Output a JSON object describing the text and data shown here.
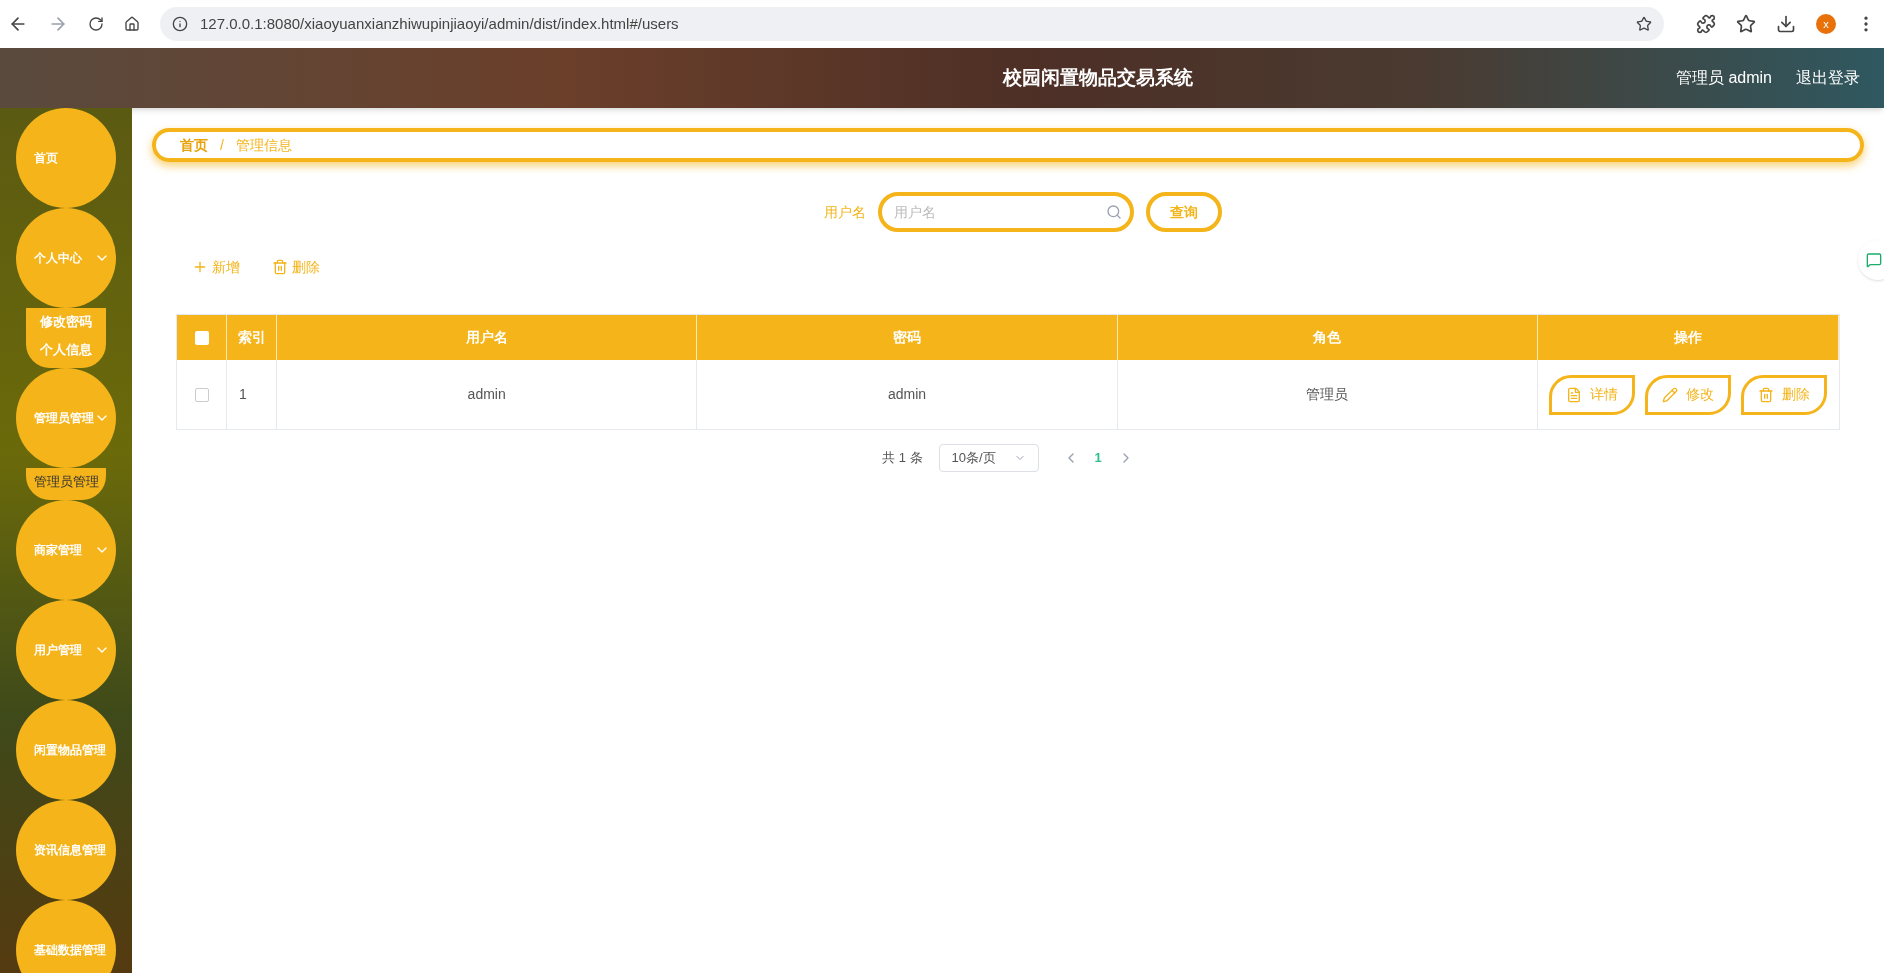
{
  "browser": {
    "url": "127.0.0.1:8080/xiaoyuanxianzhiwupinjiaoyi/admin/dist/index.html#/users",
    "profile": "x"
  },
  "header": {
    "title": "校园闲置物品交易系统",
    "user": "管理员 admin",
    "logout": "退出登录"
  },
  "sidebar": {
    "items": [
      {
        "label": "首页",
        "expandable": false
      },
      {
        "label": "个人中心",
        "expandable": true,
        "children": [
          {
            "label": "修改密码",
            "selected": false
          },
          {
            "label": "个人信息",
            "selected": false
          }
        ]
      },
      {
        "label": "管理员管理",
        "expandable": true,
        "children": [
          {
            "label": "管理员管理",
            "selected": true
          }
        ]
      },
      {
        "label": "商家管理",
        "expandable": true
      },
      {
        "label": "用户管理",
        "expandable": true
      },
      {
        "label": "闲置物品管理",
        "expandable": false
      },
      {
        "label": "资讯信息管理",
        "expandable": false
      },
      {
        "label": "基础数据管理",
        "expandable": false
      }
    ]
  },
  "breadcrumb_separator": "/",
  "breadcrumb": [
    {
      "label": "首页",
      "current": false
    },
    {
      "label": "管理信息",
      "current": true
    }
  ],
  "search": {
    "label": "用户名",
    "placeholder": "用户名",
    "button": "查询"
  },
  "actions": [
    {
      "kind": "add",
      "label": "新增"
    },
    {
      "kind": "delete",
      "label": "删除"
    }
  ],
  "table": {
    "select_all": {
      "checked": false
    },
    "columns": [
      "索引",
      "用户名",
      "密码",
      "角色",
      "操作"
    ],
    "rows": [
      {
        "checked": false,
        "cells": [
          "1",
          "admin",
          "admin",
          "管理员"
        ],
        "actions": [
          {
            "kind": "detail",
            "label": "详情"
          },
          {
            "kind": "edit",
            "label": "修改"
          },
          {
            "kind": "delete",
            "label": "删除"
          }
        ]
      }
    ]
  },
  "pagination": {
    "total": "共 1 条",
    "page_size": "10条/页",
    "pages": [
      {
        "label": "1",
        "selected": true
      }
    ]
  }
}
